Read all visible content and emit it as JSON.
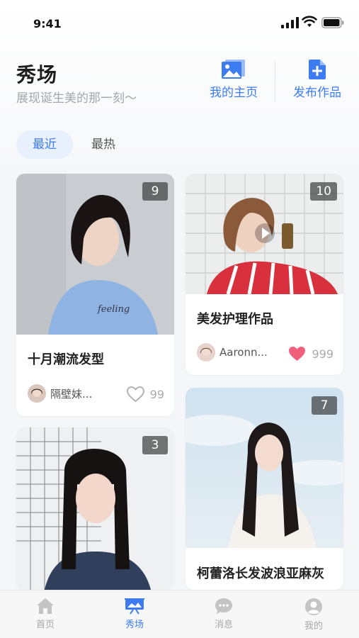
{
  "status_bar": {
    "time": "9:41"
  },
  "header": {
    "title": "秀场",
    "subtitle": "展现诞生美的那一刻～",
    "actions": [
      {
        "label": "我的主页",
        "icon": "image-icon"
      },
      {
        "label": "发布作品",
        "icon": "add-file-icon"
      }
    ]
  },
  "tabs": [
    {
      "label": "最近",
      "active": true
    },
    {
      "label": "最热",
      "active": false
    }
  ],
  "cards": [
    {
      "title": "十月潮流发型",
      "count": "9",
      "author": "隔壁妹...",
      "likes": "99",
      "liked": false
    },
    {
      "title": "美发护理作品",
      "count": "10",
      "author": "Aaronn...",
      "likes": "999",
      "liked": true,
      "has_video": true
    },
    {
      "title": "",
      "count": "3"
    },
    {
      "title": "柯蕾洛长发波浪亚麻灰",
      "count": "7"
    }
  ],
  "bottom_nav": [
    {
      "label": "首页",
      "icon": "home-icon",
      "active": false
    },
    {
      "label": "秀场",
      "icon": "showcase-icon",
      "active": true
    },
    {
      "label": "消息",
      "icon": "message-icon",
      "active": false
    },
    {
      "label": "我的",
      "icon": "profile-icon",
      "active": false
    }
  ],
  "colors": {
    "accent": "#3d7cf0",
    "like": "#f0607a",
    "text": "#222222",
    "muted": "#a3a6ad"
  }
}
